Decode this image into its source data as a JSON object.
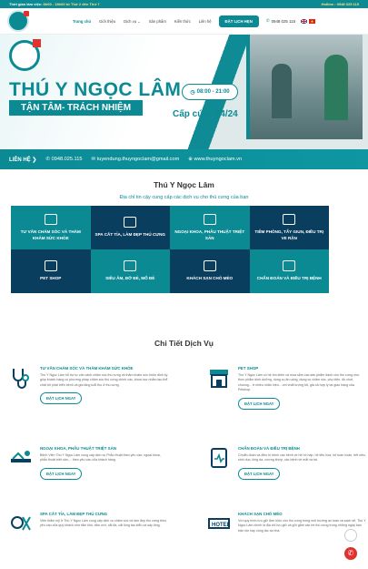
{
  "topbar": {
    "hours_label": "Thời gian làm việc:",
    "hours_value": "8h00 - 18h00 từ Thứ 2 đến Thứ 7",
    "hotline": "Hotline : 0948 025 115"
  },
  "nav": {
    "menu": [
      "Trang chủ",
      "Giới thiệu",
      "Dịch vụ ⌄",
      "Sản phẩm",
      "Kiến thức",
      "Liên hệ"
    ],
    "book": "ĐẶT LỊCH HẸN",
    "phone": "0948 025 115"
  },
  "banner": {
    "title": "THÚ Y NGỌC LÂM",
    "subtitle": "TẬN TÂM- TRÁCH NHIỆM",
    "time": "08:00 - 21:00",
    "care": "Cấp cứu: 24/24",
    "contact_label": "LIÊN HỆ ❯",
    "phone": "0948.025.115",
    "email": "tuyendung.thuyngoclam@gmail.com",
    "web": "www.thuyngoclam.vn"
  },
  "intro": {
    "title": "Thú Y Ngọc Lâm",
    "tagline": "Địa chỉ tin cậy cung cấp các dịch vụ cho thú cưng của bạn"
  },
  "grid": [
    {
      "label": "TƯ VẤN CHĂM SÓC VÀ THĂM KHÁM SỨC KHỎE",
      "tone": "t"
    },
    {
      "label": "SPA CẮT TỈA, LÀM ĐẸP THÚ CƯNG",
      "tone": "d"
    },
    {
      "label": "NGOẠI KHOA, PHẪU THUẬT TRIỆT SẢN",
      "tone": "t"
    },
    {
      "label": "TIÊM PHÒNG, TẨY GIUN, ĐIỀU TRỊ VE RẬN",
      "tone": "d"
    },
    {
      "label": "PET SHOP",
      "tone": "d"
    },
    {
      "label": "SIÊU ÂM, ĐỠ ĐẺ, MỔ ĐẺ",
      "tone": "t"
    },
    {
      "label": "KHÁCH SẠN CHÓ MÈO",
      "tone": "d"
    },
    {
      "label": "CHẨN ĐOÁN VÀ ĐIỀU TRỊ BỆNH",
      "tone": "t"
    }
  ],
  "details": {
    "title": "Chi Tiết Dịch Vụ",
    "book": "ĐẶT LỊCH NGAY",
    "items": [
      {
        "title": "TƯ VẤN CHĂM SÓC VÀ THĂM KHÁM SỨC KHỎE",
        "text": "Thú Y Ngọc Lâm hỗ trợ tư vấn cách chăm sóc thú cưng và thăm khám sức khỏe định kỳ giúp khách hàng có phương pháp chăm sóc thú cưng chính xác, khoa học nhằm tạo thể chất tốt phát triển bệnh và gia tăng tuổi thọ ở thú cưng.",
        "icon": "stethoscope-icon"
      },
      {
        "title": "PET SHOP",
        "text": "Thú Y Ngọc Lâm có hệ tìm kiếm và mua sắm các sản phẩm dành cho thú cưng như thực phẩm dinh dưỡng, dụng cụ ăn uống, dụng cụ chăm sóc, phụ kiện, đồ chơi, chuồng... ở nhiều nhãn hiệu... với chất lượng tốt, giá cả hợp lý tại giao hàng của Petshop.",
        "icon": "shop-icon"
      },
      {
        "title": "NGOẠI KHOA, PHẪU THUẬT TRIỆT SẢN",
        "text": "Bệnh Viện Thú Y Ngọc Lâm cung cấp dịch vụ Phẫu thuật theo yêu cầu: ngoại khoa, phẫu thuật triệt sản,... theo yêu cầu của khách hàng.",
        "icon": "surgery-icon"
      },
      {
        "title": "CHẨN ĐOÁN VÀ ĐIỀU TRỊ BỆNH",
        "text": "Chuẩn đoán và điều trị bệnh các bệnh về hệ hô hấp, hệ tiêu hóa, hệ tuần hoàn, tiết niệu, sinh dục, lông da, xương khớp, các bệnh về mắt và tai.",
        "icon": "diagnosis-icon"
      },
      {
        "title": "SPA CẮT TỈA, LÀM ĐẸP THÚ CƯNG",
        "text": "Viện thẩm mỹ ở Thú Y Ngọc Lâm cung cấp dịch vụ chăm sóc và làm đẹp thú cưng theo yêu cầu của quý khách như tắm khô, tắm ướt, cắt tỉa, cắt lông tạo kiểu và sấy lông.",
        "icon": "grooming-icon"
      },
      {
        "title": "KHÁCH SẠN CHÓ MÈO",
        "text": "Với quy trình lưu giữ đơn hiệu cho thú cưng trong môi trường an toàn và sạch sẽ, Thú Y Ngọc Lâm chính là địa chỉ lưu giữ và gửi gắm các bé thú cưng trong những ngày bạn bận rộn hay công tác xa nhà.",
        "icon": "hotel-icon"
      }
    ]
  }
}
